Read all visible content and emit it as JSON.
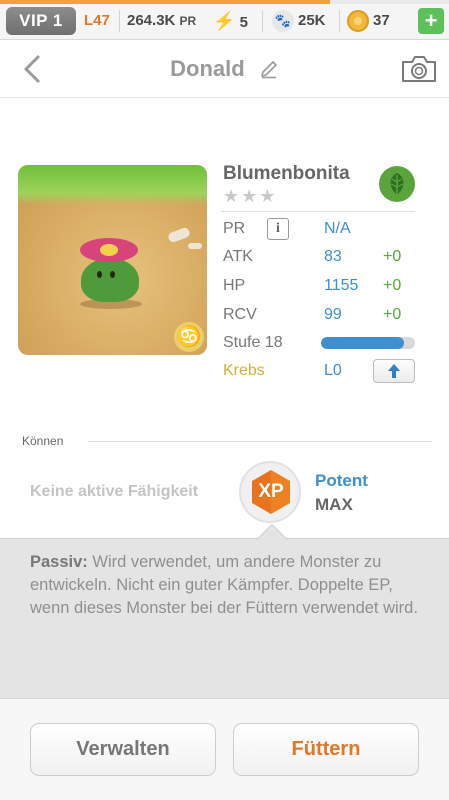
{
  "status_bar": {
    "vip_label": "VIP 1",
    "level": "L47",
    "power": "264.3K",
    "power_suffix": "PR",
    "energy": "5",
    "food": "25K",
    "coins": "37",
    "add_label": "+"
  },
  "header": {
    "title": "Donald"
  },
  "monster": {
    "name": "Blumenbonita",
    "stars": "★★★",
    "element_icon": "leaf-icon",
    "sign_icon": "cancer-zodiac-icon",
    "stats": {
      "pr_label": "PR",
      "pr_info": "i",
      "pr_value": "N/A",
      "atk_label": "ATK",
      "atk_value": "83",
      "atk_delta": "+0",
      "hp_label": "HP",
      "hp_value": "1155",
      "hp_delta": "+0",
      "rcv_label": "RCV",
      "rcv_value": "99",
      "rcv_delta": "+0",
      "stufe_label": "Stufe 18",
      "stufe_progress": 0.88,
      "sign_label": "Krebs",
      "sign_level": "L0"
    }
  },
  "skills": {
    "section_label": "Können",
    "active_none": "Keine aktive Fähigkeit",
    "xp_badge": "XP",
    "skill_name": "Potent",
    "skill_level": "MAX",
    "passive_prefix": "Passiv:",
    "passive_text": " Wird verwendet, um andere Monster zu entwickeln. Nicht ein guter Kämpfer. Doppelte EP, wenn dieses Monster bei der Füttern verwendet wird."
  },
  "actions": {
    "manage_label": "Verwalten",
    "feed_label": "Füttern"
  },
  "colors": {
    "accent_orange": "#e0772a",
    "accent_blue": "#3e8fd0",
    "positive_green": "#53a93a",
    "sign_yellow": "#cfb23a"
  }
}
